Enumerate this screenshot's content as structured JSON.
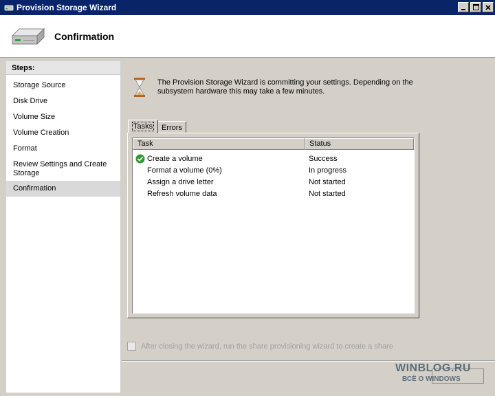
{
  "window": {
    "title": "Provision Storage Wizard"
  },
  "header": {
    "title": "Confirmation"
  },
  "sidebar": {
    "heading": "Steps:",
    "items": [
      {
        "label": "Storage Source"
      },
      {
        "label": "Disk Drive"
      },
      {
        "label": "Volume Size"
      },
      {
        "label": "Volume Creation"
      },
      {
        "label": "Format"
      },
      {
        "label": "Review Settings and Create Storage"
      },
      {
        "label": "Confirmation"
      }
    ]
  },
  "main": {
    "info": "The Provision Storage Wizard is committing your settings. Depending on the subsystem hardware this may take a few minutes.",
    "tabs": [
      {
        "label": "Tasks"
      },
      {
        "label": "Errors"
      }
    ],
    "table": {
      "columns": [
        "Task",
        "Status"
      ],
      "rows": [
        {
          "task": "Create a volume",
          "status": "Success",
          "icon": "check-icon"
        },
        {
          "task": "Format a volume (0%)",
          "status": "In progress"
        },
        {
          "task": "Assign a drive letter",
          "status": "Not started"
        },
        {
          "task": "Refresh volume data",
          "status": "Not started"
        }
      ]
    },
    "share_option": "After closing the wizard, run the share provisioning wizard to create a share"
  },
  "watermark": {
    "line1": "WINBLOG.RU",
    "line2": "ВСЁ О WINDOWS"
  },
  "colors": {
    "titlebar": "#0a246a",
    "dialog": "#d4d0c8",
    "success": "#2e9b2e"
  }
}
